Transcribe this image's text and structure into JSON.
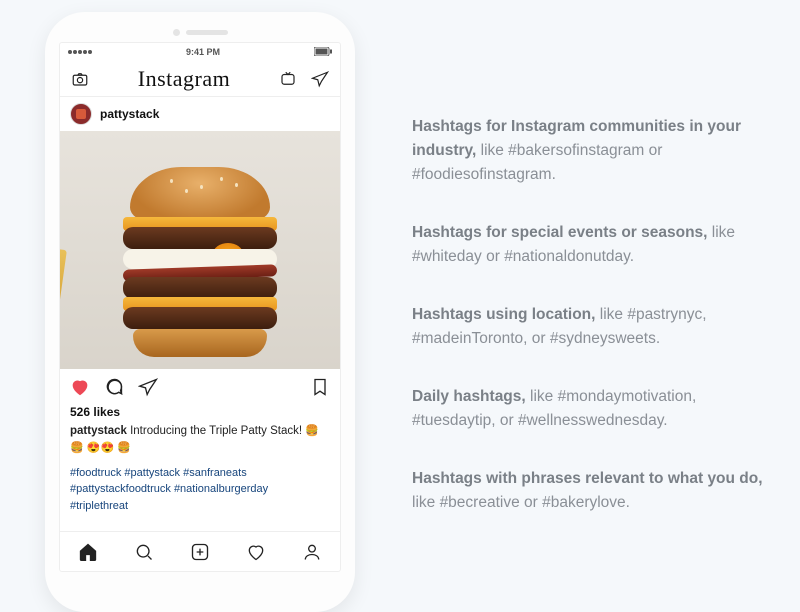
{
  "phone": {
    "time": "9:41 PM",
    "app_logo_text": "Instagram",
    "post": {
      "username": "pattystack",
      "likes_label": "526 likes",
      "caption_user": "pattystack",
      "caption_text": "Introducing the Triple Patty Stack!",
      "caption_emoji": "🍔🍔 😍😍 🍔",
      "hashtags_line1": "#foodtruck #pattystack #sanfraneats",
      "hashtags_line2": "#pattystackfoodtruck #nationalburgerday",
      "hashtags_line3": "#triplethreat"
    }
  },
  "tips": [
    {
      "bold": "Hashtags for Instagram communities in your industry,",
      "rest": " like #bakersofinstagram or #foodiesofinstagram."
    },
    {
      "bold": "Hashtags for special events or seasons,",
      "rest": " like #whiteday or #nationaldonutday."
    },
    {
      "bold": "Hashtags using location,",
      "rest": " like #pastrynyc, #madeinToronto, or #sydneysweets."
    },
    {
      "bold": "Daily hashtags,",
      "rest": " like #mondaymotivation, #tuesdaytip, or #wellnesswednesday."
    },
    {
      "bold": "Hashtags with phrases relevant to what you do,",
      "rest": " like #becreative or #bakerylove."
    }
  ]
}
